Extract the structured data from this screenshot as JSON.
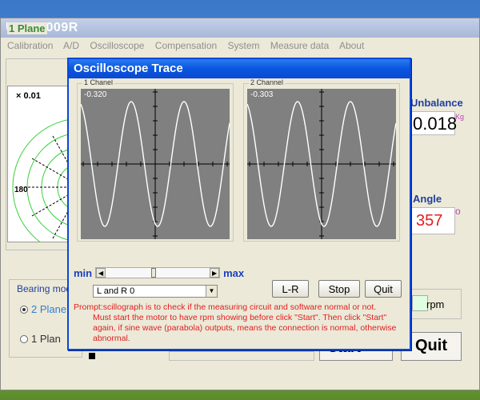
{
  "main_window": {
    "title": "USB-2009R",
    "menu": [
      "Calibration",
      "A/D",
      "Oscilloscope",
      "Compensation",
      "System",
      "Measure data",
      "About"
    ],
    "plane_label": "1 Plane",
    "scale_label": "× 0.01",
    "degree_label": "180",
    "unbalance": {
      "label": "Unbalance",
      "value": "0.018",
      "unit": "Kg"
    },
    "angle": {
      "label": "Angle",
      "value": "357",
      "unit": "o"
    },
    "bearing_mode": {
      "label": "Bearing mod",
      "options": [
        "2 Plane",
        "1 Plan"
      ],
      "selected": "2 Plane"
    },
    "rpm_label": "rpm",
    "start_label": "Start",
    "quit_label": "Quit"
  },
  "dialog": {
    "title": "Oscilloscope Trace",
    "channel1": {
      "label": "1 Chanel",
      "value": "-0.320"
    },
    "channel2": {
      "label": "2  Channel",
      "value": "-0.303"
    },
    "slider": {
      "min_label": "min",
      "max_label": "max",
      "position": 0.45
    },
    "mode_select": {
      "value": "L and R 0"
    },
    "buttons": {
      "lr": "L-R",
      "stop": "Stop",
      "quit": "Quit"
    },
    "prompt": {
      "line1": "Prompt:scillograph is to check if the measuring circuit and software normal or not.",
      "line2": "Must start the motor to have rpm showing before click \"Start\". Then click \"Start\" again, if sine wave (parabola) outputs, means the connection is normal, otherwise abnormal."
    }
  },
  "colors": {
    "scope_bg": "#808080",
    "trace": "#ffffff",
    "accent_blue": "#0a46d8",
    "prompt_red": "#e02020"
  }
}
